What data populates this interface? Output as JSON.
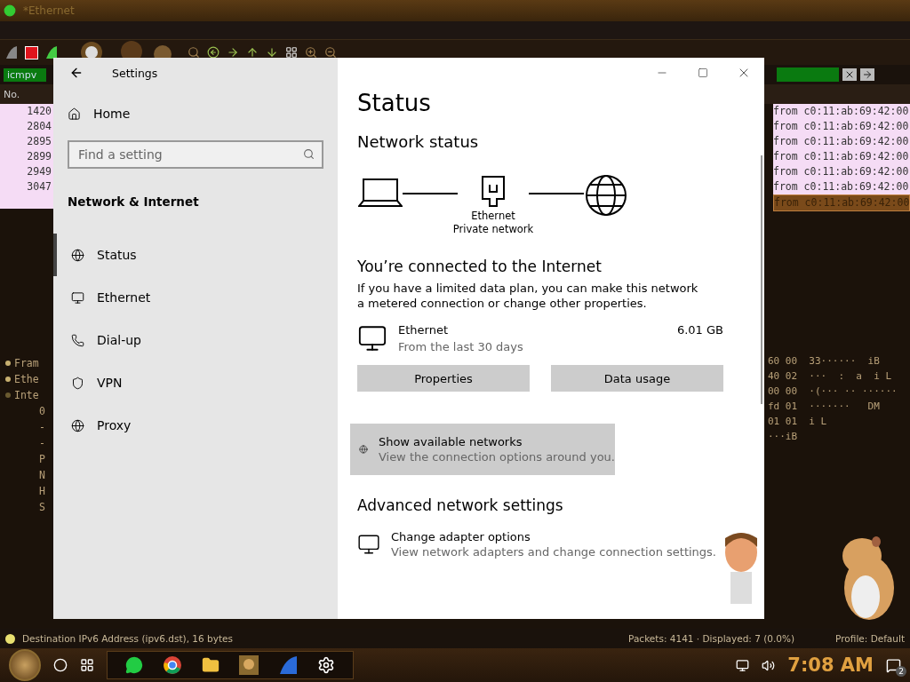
{
  "background_app": {
    "title": "*Ethernet",
    "filter": "icmpv",
    "column_1": "No.",
    "packet_numbers": [
      "1420",
      "2804",
      "2895",
      "2899",
      "2949",
      "3047"
    ],
    "packet_info": [
      {
        "text": "from c0:11:ab:69:42:00",
        "selected": false
      },
      {
        "text": "from c0:11:ab:69:42:00",
        "selected": false
      },
      {
        "text": "from c0:11:ab:69:42:00",
        "selected": false
      },
      {
        "text": "from c0:11:ab:69:42:00",
        "selected": false
      },
      {
        "text": "from c0:11:ab:69:42:00",
        "selected": false
      },
      {
        "text": "from c0:11:ab:69:42:00",
        "selected": false
      },
      {
        "text": "from c0:11:ab:69:42:00",
        "selected": true
      }
    ],
    "details": [
      {
        "text": "Fram",
        "expanded": false
      },
      {
        "text": "Ethe",
        "expanded": false
      },
      {
        "text": "Inte",
        "expanded": true
      }
    ],
    "detail_lines": [
      "0",
      "-",
      "-",
      "P",
      "N",
      "H",
      "S"
    ],
    "bytes": [
      "60 00  33······  iB",
      "40 02  ···  :  a  i L",
      "00 00  ·(··· ·· ······",
      "fd 01  ·······   DM",
      "01 01  i L",
      "···iB"
    ],
    "status": {
      "field": "Destination IPv6 Address (ipv6.dst), 16 bytes",
      "packets": "Packets: 4141 · Displayed: 7 (0.0%)",
      "profile": "Profile: Default"
    }
  },
  "window": {
    "title": "Settings"
  },
  "sidebar": {
    "home": "Home",
    "search": {
      "placeholder": "Find a setting"
    },
    "section": "Network & Internet",
    "items": [
      {
        "label": "Status",
        "kind": "globe",
        "selected": true
      },
      {
        "label": "Ethernet",
        "kind": "monitor",
        "selected": false
      },
      {
        "label": "Dial-up",
        "kind": "phone",
        "selected": false
      },
      {
        "label": "VPN",
        "kind": "vpn",
        "selected": false
      },
      {
        "label": "Proxy",
        "kind": "globe",
        "selected": false
      }
    ]
  },
  "main": {
    "title": "Status",
    "network_status": "Network status",
    "adapter": "Ethernet",
    "network_type": "Private network",
    "connected": "You’re connected to the Internet",
    "description": "If you have a limited data plan, you can make this network a metered connection or change other properties.",
    "usage": {
      "name": "Ethernet",
      "period": "From the last 30 days",
      "amount": "6.01 GB"
    },
    "buttons": [
      "Properties",
      "Data usage"
    ],
    "show_networks": {
      "title": "Show available networks",
      "subtitle": "View the connection options around you."
    },
    "advanced": "Advanced network settings",
    "adapter_options": {
      "title": "Change adapter options",
      "subtitle": "View network adapters and change connection settings."
    }
  },
  "taskbar": {
    "clock": "7:08 AM",
    "notifications": "2"
  }
}
